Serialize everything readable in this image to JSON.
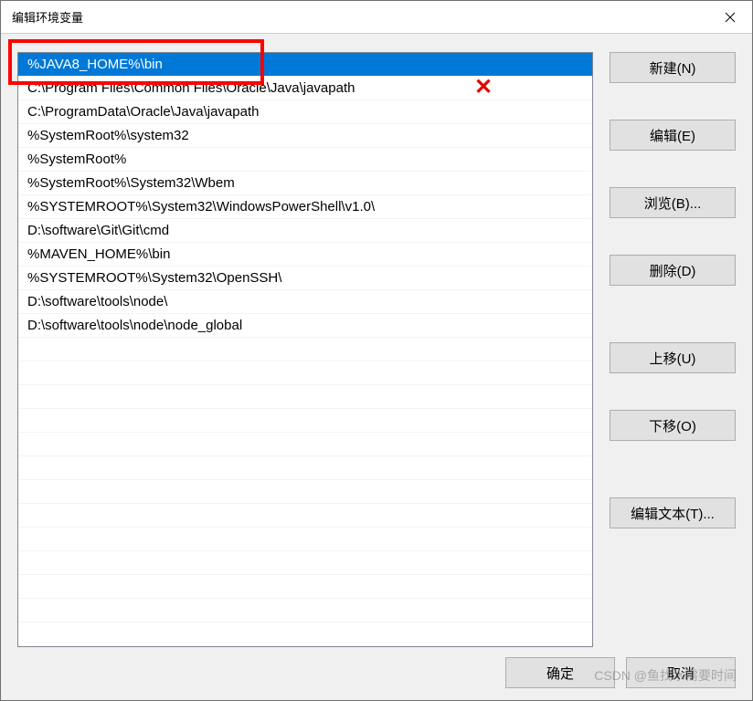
{
  "titlebar": {
    "title": "编辑环境变量"
  },
  "list": {
    "items": [
      "%JAVA8_HOME%\\bin",
      "C:\\Program Files\\Common Files\\Oracle\\Java\\javapath",
      "C:\\ProgramData\\Oracle\\Java\\javapath",
      "%SystemRoot%\\system32",
      "%SystemRoot%",
      "%SystemRoot%\\System32\\Wbem",
      "%SYSTEMROOT%\\System32\\WindowsPowerShell\\v1.0\\",
      "D:\\software\\Git\\Git\\cmd",
      "%MAVEN_HOME%\\bin",
      "%SYSTEMROOT%\\System32\\OpenSSH\\",
      "D:\\software\\tools\\node\\",
      "D:\\software\\tools\\node\\node_global"
    ],
    "selected_index": 0
  },
  "buttons": {
    "new": "新建(N)",
    "edit": "编辑(E)",
    "browse": "浏览(B)...",
    "delete": "删除(D)",
    "move_up": "上移(U)",
    "move_down": "下移(O)",
    "edit_text": "编辑文本(T)...",
    "ok": "确定",
    "cancel": "取消"
  },
  "watermark": "CSDN @鱼找水需要时间"
}
